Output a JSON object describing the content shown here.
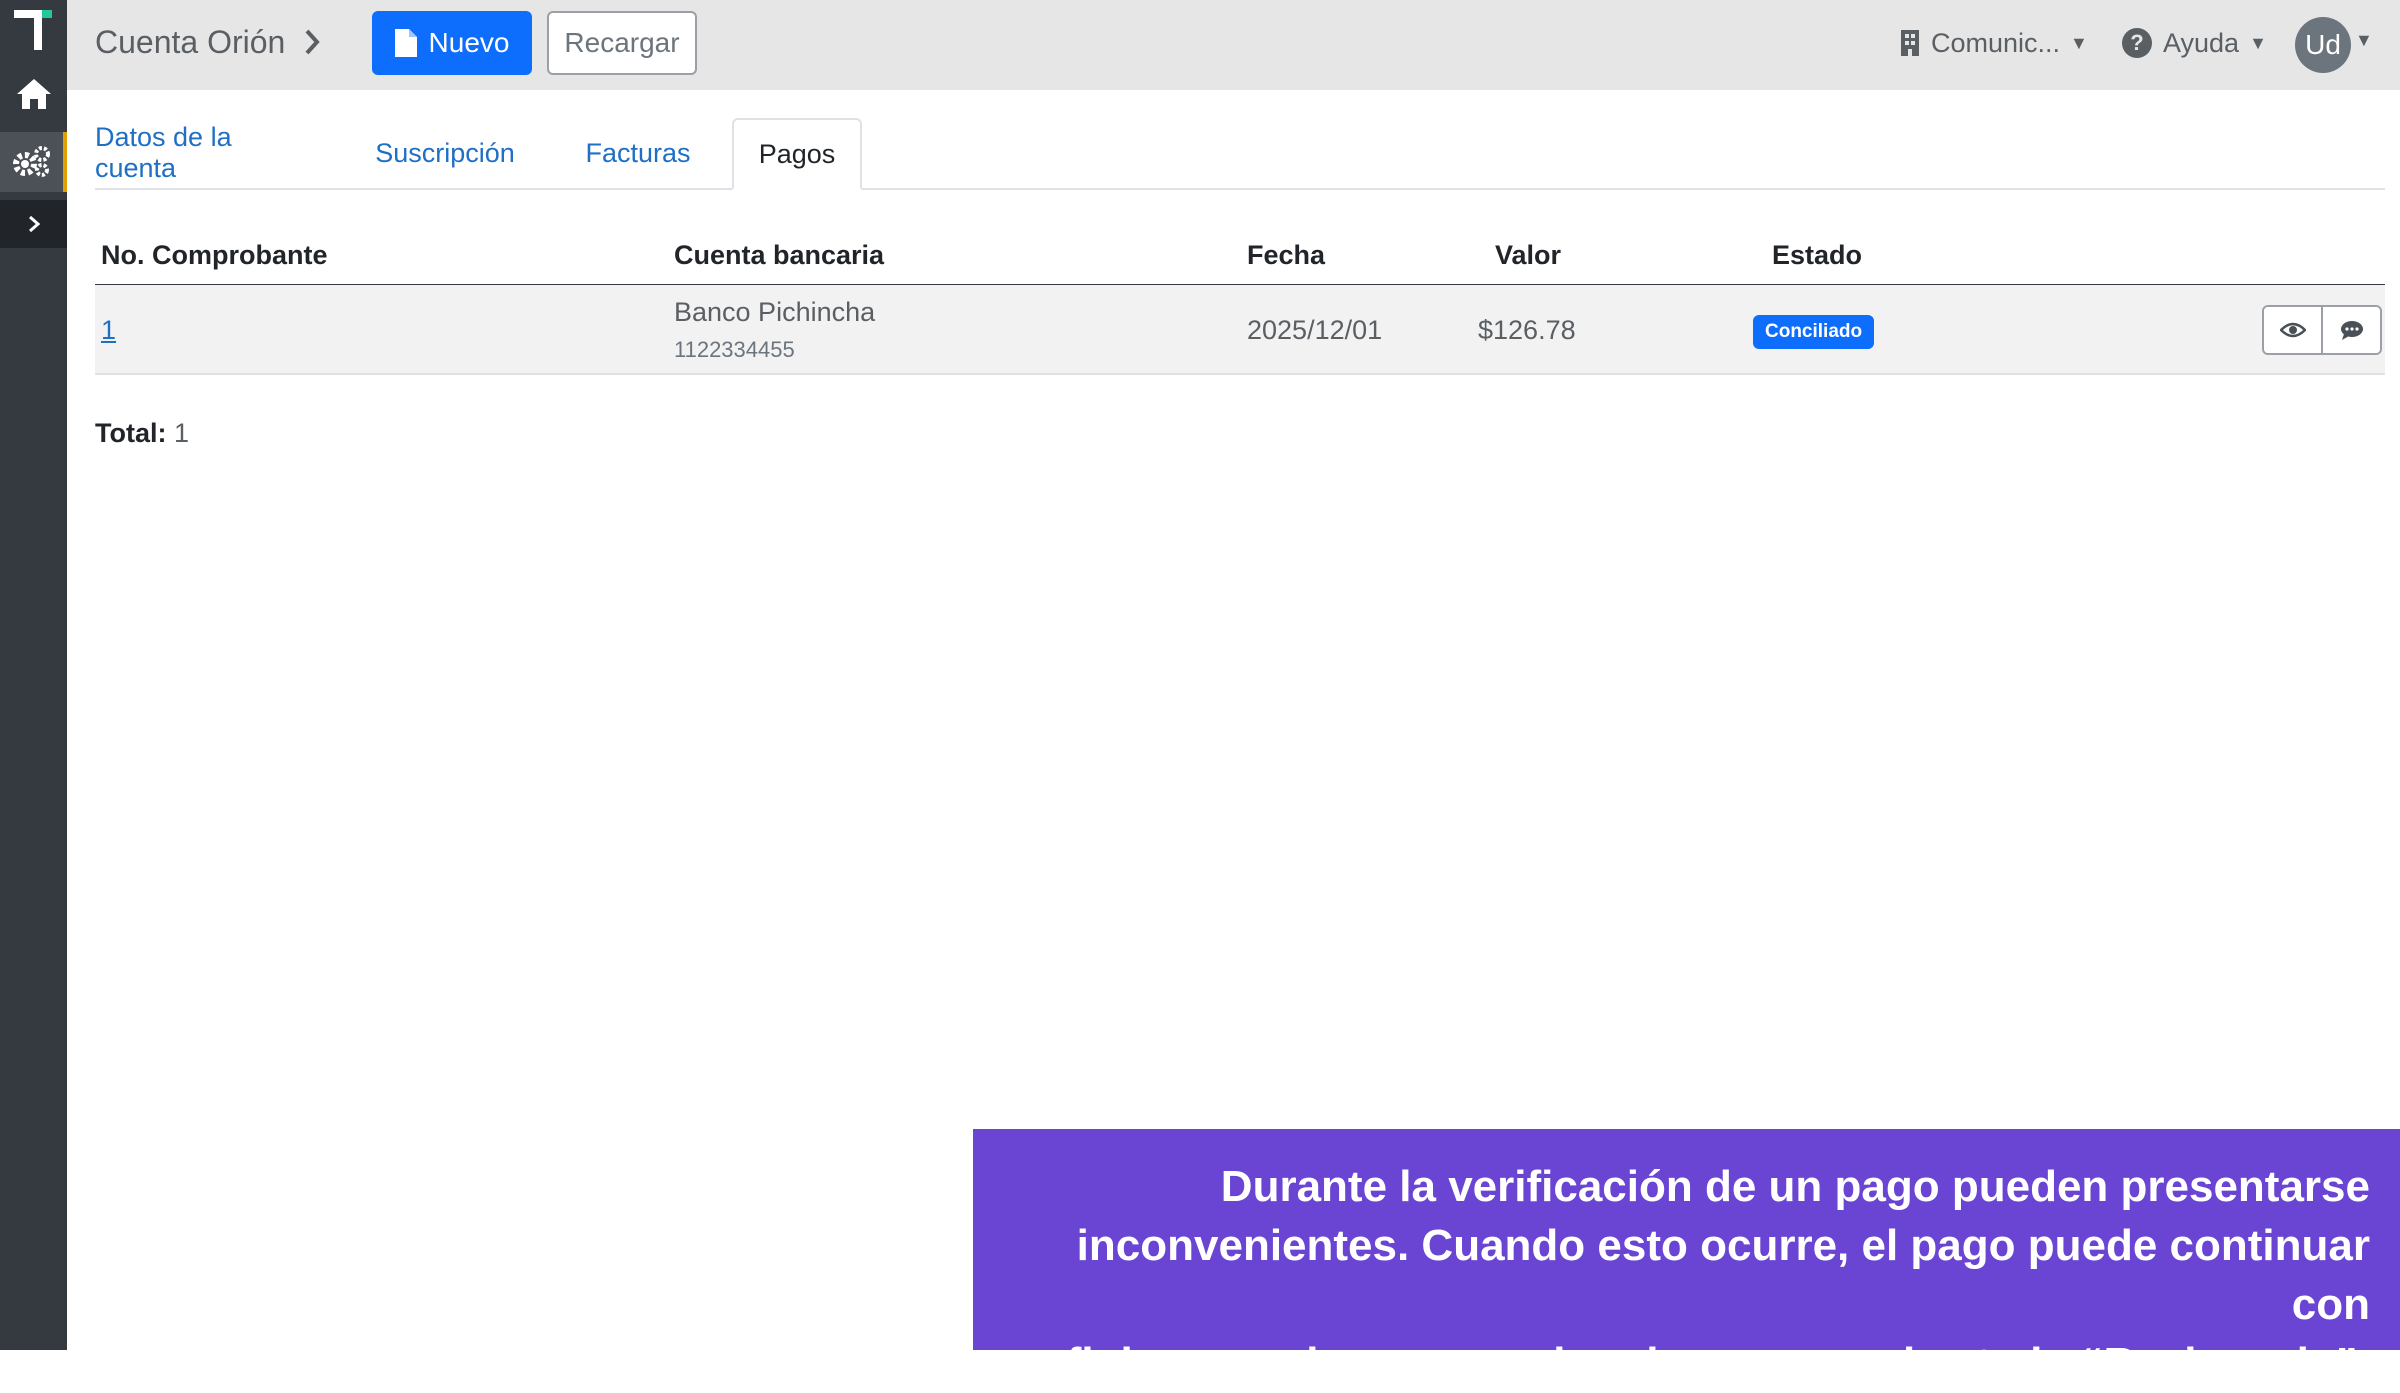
{
  "topbar": {
    "breadcrumb": "Cuenta Orión",
    "new_button": "Nuevo",
    "reload_button": "Recargar",
    "company_menu": "Comunic...",
    "help_menu": "Ayuda",
    "user_initials": "Ud"
  },
  "tabs": [
    "Datos de la cuenta",
    "Suscripción",
    "Facturas",
    "Pagos"
  ],
  "active_tab": "Pagos",
  "table": {
    "headers": [
      "No. Comprobante",
      "Cuenta bancaria",
      "Fecha",
      "Valor",
      "Estado"
    ],
    "rows": [
      {
        "number": "1",
        "bank": "Banco Pichincha",
        "account": "1122334455",
        "date": "2025/12/01",
        "value": "$126.78",
        "status": "Conciliado"
      }
    ]
  },
  "total_label": "Total:",
  "total_value": "1",
  "caption": {
    "line1": "Durante la verificación de un pago pueden presentarse",
    "line2": "inconvenientes. Cuando esto ocurre, el pago puede continuar con",
    "line3": "su flujo normal una vez aclarado, o pasar al estado “Rechazado”."
  },
  "colors": {
    "primary": "#0d6efd",
    "sidebar": "#343a40",
    "topbar": "#e6e6e6",
    "caption_bg": "#6a45d3",
    "link": "#1f6fc5"
  },
  "icons": [
    "app-logo-icon",
    "home-icon",
    "settings-gears-icon",
    "chevron-right-icon",
    "file-icon",
    "building-icon",
    "question-circle-icon",
    "eye-icon",
    "comment-icon"
  ]
}
